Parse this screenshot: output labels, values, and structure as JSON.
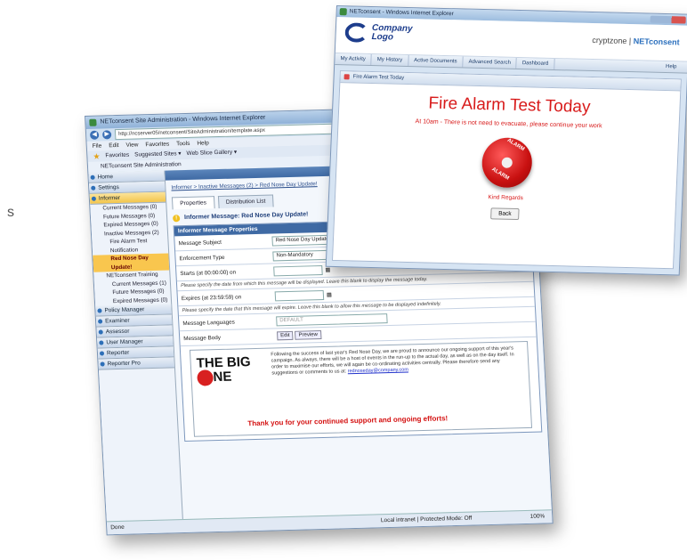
{
  "stray_char": "s",
  "admin_window": {
    "title": "NETconsent Site Administration - Windows Internet Explorer",
    "address": "http://ncserver05/netconsent/SiteAdministration/template.aspx",
    "menu": [
      "File",
      "Edit",
      "View",
      "Favorites",
      "Tools",
      "Help"
    ],
    "favorites": {
      "label": "Favorites",
      "suggested": "Suggested Sites ▾",
      "gallery": "Web Slice Gallery ▾"
    },
    "tab": "NETconsent Site Administration",
    "sidebar": {
      "home": "Home",
      "settings": "Settings",
      "informer": "Informer",
      "items": [
        "Current Messages (0)",
        "Future Messages (0)",
        "Expired Messages (0)",
        "Inactive Messages (2)"
      ],
      "children": [
        "Fire Alarm Test Notification",
        "Red Nose Day Update!"
      ],
      "training": "NETconsent Training",
      "training_items": [
        "Current Messages (1)",
        "Future Messages (0)",
        "Expired Messages (0)"
      ],
      "sections": [
        "Policy Manager",
        "Examiner",
        "Assessor",
        "User Manager",
        "Reporter",
        "Reporter Pro"
      ]
    },
    "main": {
      "header": "Informer",
      "breadcrumb": "Informer > Inactive Messages (2) > Red Nose Day Update!",
      "tabs": [
        "Properties",
        "Distribution List"
      ],
      "message_heading": "Informer Message: Red Nose Day Update!",
      "props_title": "Informer Message Properties",
      "subject_label": "Message Subject",
      "subject_value": "Red Nose Day Update!",
      "enforcement_label": "Enforcement Type",
      "enforcement_value": "Non-Mandatory",
      "starts_label": "Starts (at 00:00:00) on",
      "starts_hint": "Please specify the date from which this message will be displayed. Leave this blank to display the message today.",
      "expires_label": "Expires (at 23:59:59) on",
      "expires_hint": "Please specify the date that this message will expire. Leave this blank to allow this message to be displayed indefinitely.",
      "languages_label": "Message Languages",
      "languages_value": "DEFAULT",
      "body_label": "Message Body",
      "edit_btn": "Edit",
      "preview_btn": "Preview",
      "bigone_top": "THE BIG",
      "bigone_bottom": "NE",
      "body_text": "Following the success of last year's Red Nose Day, we are proud to announce our ongoing support of this year's campaign. As always, there will be a host of events in the run-up to the actual day, as well as on the day itself. In order to maximise our efforts, we will again be co-ordinating activities centrally. Please therefore send any suggestions or comments to us at:",
      "body_link": "rednoseday@company.com",
      "thanks": "Thank you for your continued support and ongoing efforts!"
    },
    "status": {
      "left": "Done",
      "zone": "Local intranet | Protected Mode: Off",
      "zoom": "100%"
    }
  },
  "alarm_window": {
    "title": "NETconsent - Windows Internet Explorer",
    "logo_line1": "Company",
    "logo_line2": "Logo",
    "brand": "cryptzone",
    "brand2": "NETconsent",
    "nav": [
      "My Activity",
      "My History",
      "Active Documents",
      "Advanced Search",
      "Dashboard"
    ],
    "help": "Help",
    "subheader": "Fire Alarm Test Today",
    "heading": "Fire Alarm Test Today",
    "subtext": "At 10am - There is not need to evacuate, please continue your work",
    "bell_text": "ALARM",
    "regards": "Kind Regards",
    "back_button": "Back"
  }
}
